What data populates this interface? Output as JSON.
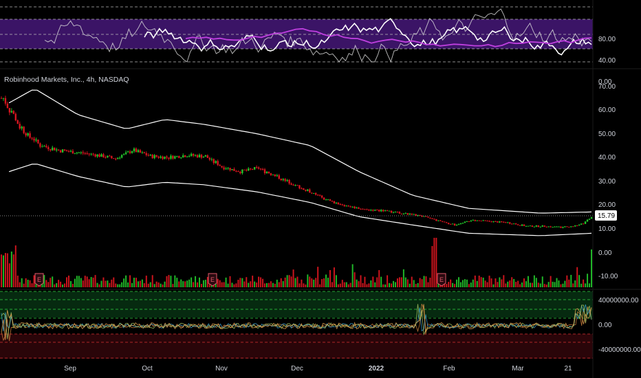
{
  "colors": {
    "up": "#22c12a",
    "down": "#d6161f",
    "band": "#ffffff",
    "rsi_fill": "#3b1466",
    "rsi_line_main": "#ffffff",
    "rsi_line_ma": "#c040e0",
    "osc_upper_fill": "#062a10",
    "osc_lower_fill": "#2a0509",
    "dash_green": "#2ecc40",
    "dash_red": "#d03030"
  },
  "price_panel": {
    "title": "Robinhood Markets, Inc., 4h, NASDAQ",
    "y_ticks": [
      "70.00",
      "60.00",
      "50.00",
      "40.00",
      "30.00",
      "20.00",
      "10.00",
      "0.00",
      "-10.00"
    ],
    "last_price": "15.79"
  },
  "rsi_panel": {
    "y_ticks": [
      "80.00",
      "40.00",
      "0.00"
    ]
  },
  "osc_panel": {
    "y_ticks": [
      "40000000.00",
      "0.00",
      "-40000000.00"
    ]
  },
  "x_axis": {
    "labels": [
      "Sep",
      "Oct",
      "Nov",
      "Dec",
      "2022",
      "Feb",
      "Mar",
      "21"
    ]
  },
  "earnings_markers": [
    "E",
    "E",
    "E"
  ],
  "chart_data": {
    "type": "candlestick",
    "title": "Robinhood Markets, Inc., 4h, NASDAQ",
    "timeframe": "4h",
    "x_range": [
      "2021-08",
      "2022-03-21"
    ],
    "ylim": [
      -12,
      75
    ],
    "last_price": 15.79,
    "close_path": [
      {
        "date": "2021-08-02",
        "close": 66
      },
      {
        "date": "2021-08-10",
        "close": 52
      },
      {
        "date": "2021-08-17",
        "close": 46
      },
      {
        "date": "2021-08-24",
        "close": 44
      },
      {
        "date": "2021-09-01",
        "close": 43
      },
      {
        "date": "2021-09-08",
        "close": 42
      },
      {
        "date": "2021-09-15",
        "close": 40.5
      },
      {
        "date": "2021-09-22",
        "close": 44
      },
      {
        "date": "2021-09-29",
        "close": 41.5
      },
      {
        "date": "2021-10-06",
        "close": 41
      },
      {
        "date": "2021-10-13",
        "close": 42
      },
      {
        "date": "2021-10-20",
        "close": 41.5
      },
      {
        "date": "2021-10-27",
        "close": 37
      },
      {
        "date": "2021-11-03",
        "close": 35
      },
      {
        "date": "2021-11-10",
        "close": 36.5
      },
      {
        "date": "2021-11-17",
        "close": 33
      },
      {
        "date": "2021-11-24",
        "close": 29.5
      },
      {
        "date": "2021-12-01",
        "close": 26
      },
      {
        "date": "2021-12-08",
        "close": 22.5
      },
      {
        "date": "2021-12-15",
        "close": 20.5
      },
      {
        "date": "2021-12-22",
        "close": 19
      },
      {
        "date": "2021-12-29",
        "close": 18.5
      },
      {
        "date": "2022-01-05",
        "close": 17.5
      },
      {
        "date": "2022-01-12",
        "close": 16.5
      },
      {
        "date": "2022-01-19",
        "close": 14.5
      },
      {
        "date": "2022-01-26",
        "close": 12.5
      },
      {
        "date": "2022-02-02",
        "close": 14.5
      },
      {
        "date": "2022-02-09",
        "close": 14
      },
      {
        "date": "2022-02-16",
        "close": 13.5
      },
      {
        "date": "2022-02-23",
        "close": 12
      },
      {
        "date": "2022-03-02",
        "close": 12
      },
      {
        "date": "2022-03-09",
        "close": 11.5
      },
      {
        "date": "2022-03-16",
        "close": 12.5
      },
      {
        "date": "2022-03-21",
        "close": 15.79
      }
    ],
    "upper_band": [
      {
        "date": "2021-08-05",
        "value": 64
      },
      {
        "date": "2021-08-15",
        "value": 70
      },
      {
        "date": "2021-09-01",
        "value": 59
      },
      {
        "date": "2021-09-20",
        "value": 53
      },
      {
        "date": "2021-10-05",
        "value": 57
      },
      {
        "date": "2021-10-20",
        "value": 55
      },
      {
        "date": "2021-11-10",
        "value": 51
      },
      {
        "date": "2021-12-01",
        "value": 46
      },
      {
        "date": "2021-12-20",
        "value": 35
      },
      {
        "date": "2022-01-10",
        "value": 25
      },
      {
        "date": "2022-02-01",
        "value": 19.5
      },
      {
        "date": "2022-03-01",
        "value": 17.5
      },
      {
        "date": "2022-03-21",
        "value": 18
      }
    ],
    "lower_band": [
      {
        "date": "2021-08-05",
        "value": 35
      },
      {
        "date": "2021-08-15",
        "value": 38.5
      },
      {
        "date": "2021-09-01",
        "value": 33
      },
      {
        "date": "2021-09-20",
        "value": 28.5
      },
      {
        "date": "2021-10-05",
        "value": 30.5
      },
      {
        "date": "2021-10-20",
        "value": 29.5
      },
      {
        "date": "2021-11-10",
        "value": 26.5
      },
      {
        "date": "2021-12-01",
        "value": 22
      },
      {
        "date": "2021-12-20",
        "value": 16
      },
      {
        "date": "2022-01-10",
        "value": 12.5
      },
      {
        "date": "2022-02-01",
        "value": 9
      },
      {
        "date": "2022-03-01",
        "value": 8
      },
      {
        "date": "2022-03-21",
        "value": 9
      }
    ],
    "rsi_range": [
      0,
      100
    ],
    "oscillator_range": [
      -40000000,
      40000000
    ]
  }
}
